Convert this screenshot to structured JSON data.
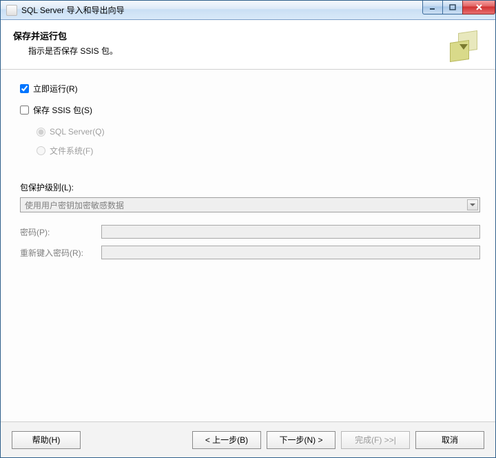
{
  "window": {
    "title": "SQL Server 导入和导出向导"
  },
  "header": {
    "title": "保存并运行包",
    "subtitle": "指示是否保存 SSIS 包。"
  },
  "options": {
    "run_now_label": "立即运行(R)",
    "run_now_checked": true,
    "save_ssis_label": "保存 SSIS 包(S)",
    "save_ssis_checked": false,
    "target_sqlserver_label": "SQL Server(Q)",
    "target_filesystem_label": "文件系统(F)"
  },
  "protection": {
    "section_label": "包保护级别(L):",
    "selected": "使用用户密钥加密敏感数据",
    "password_label": "密码(P):",
    "password_value": "",
    "repassword_label": "重新键入密码(R):",
    "repassword_value": ""
  },
  "buttons": {
    "help": "帮助(H)",
    "back": "< 上一步(B)",
    "next": "下一步(N) >",
    "finish": "完成(F) >>|",
    "cancel": "取消"
  }
}
